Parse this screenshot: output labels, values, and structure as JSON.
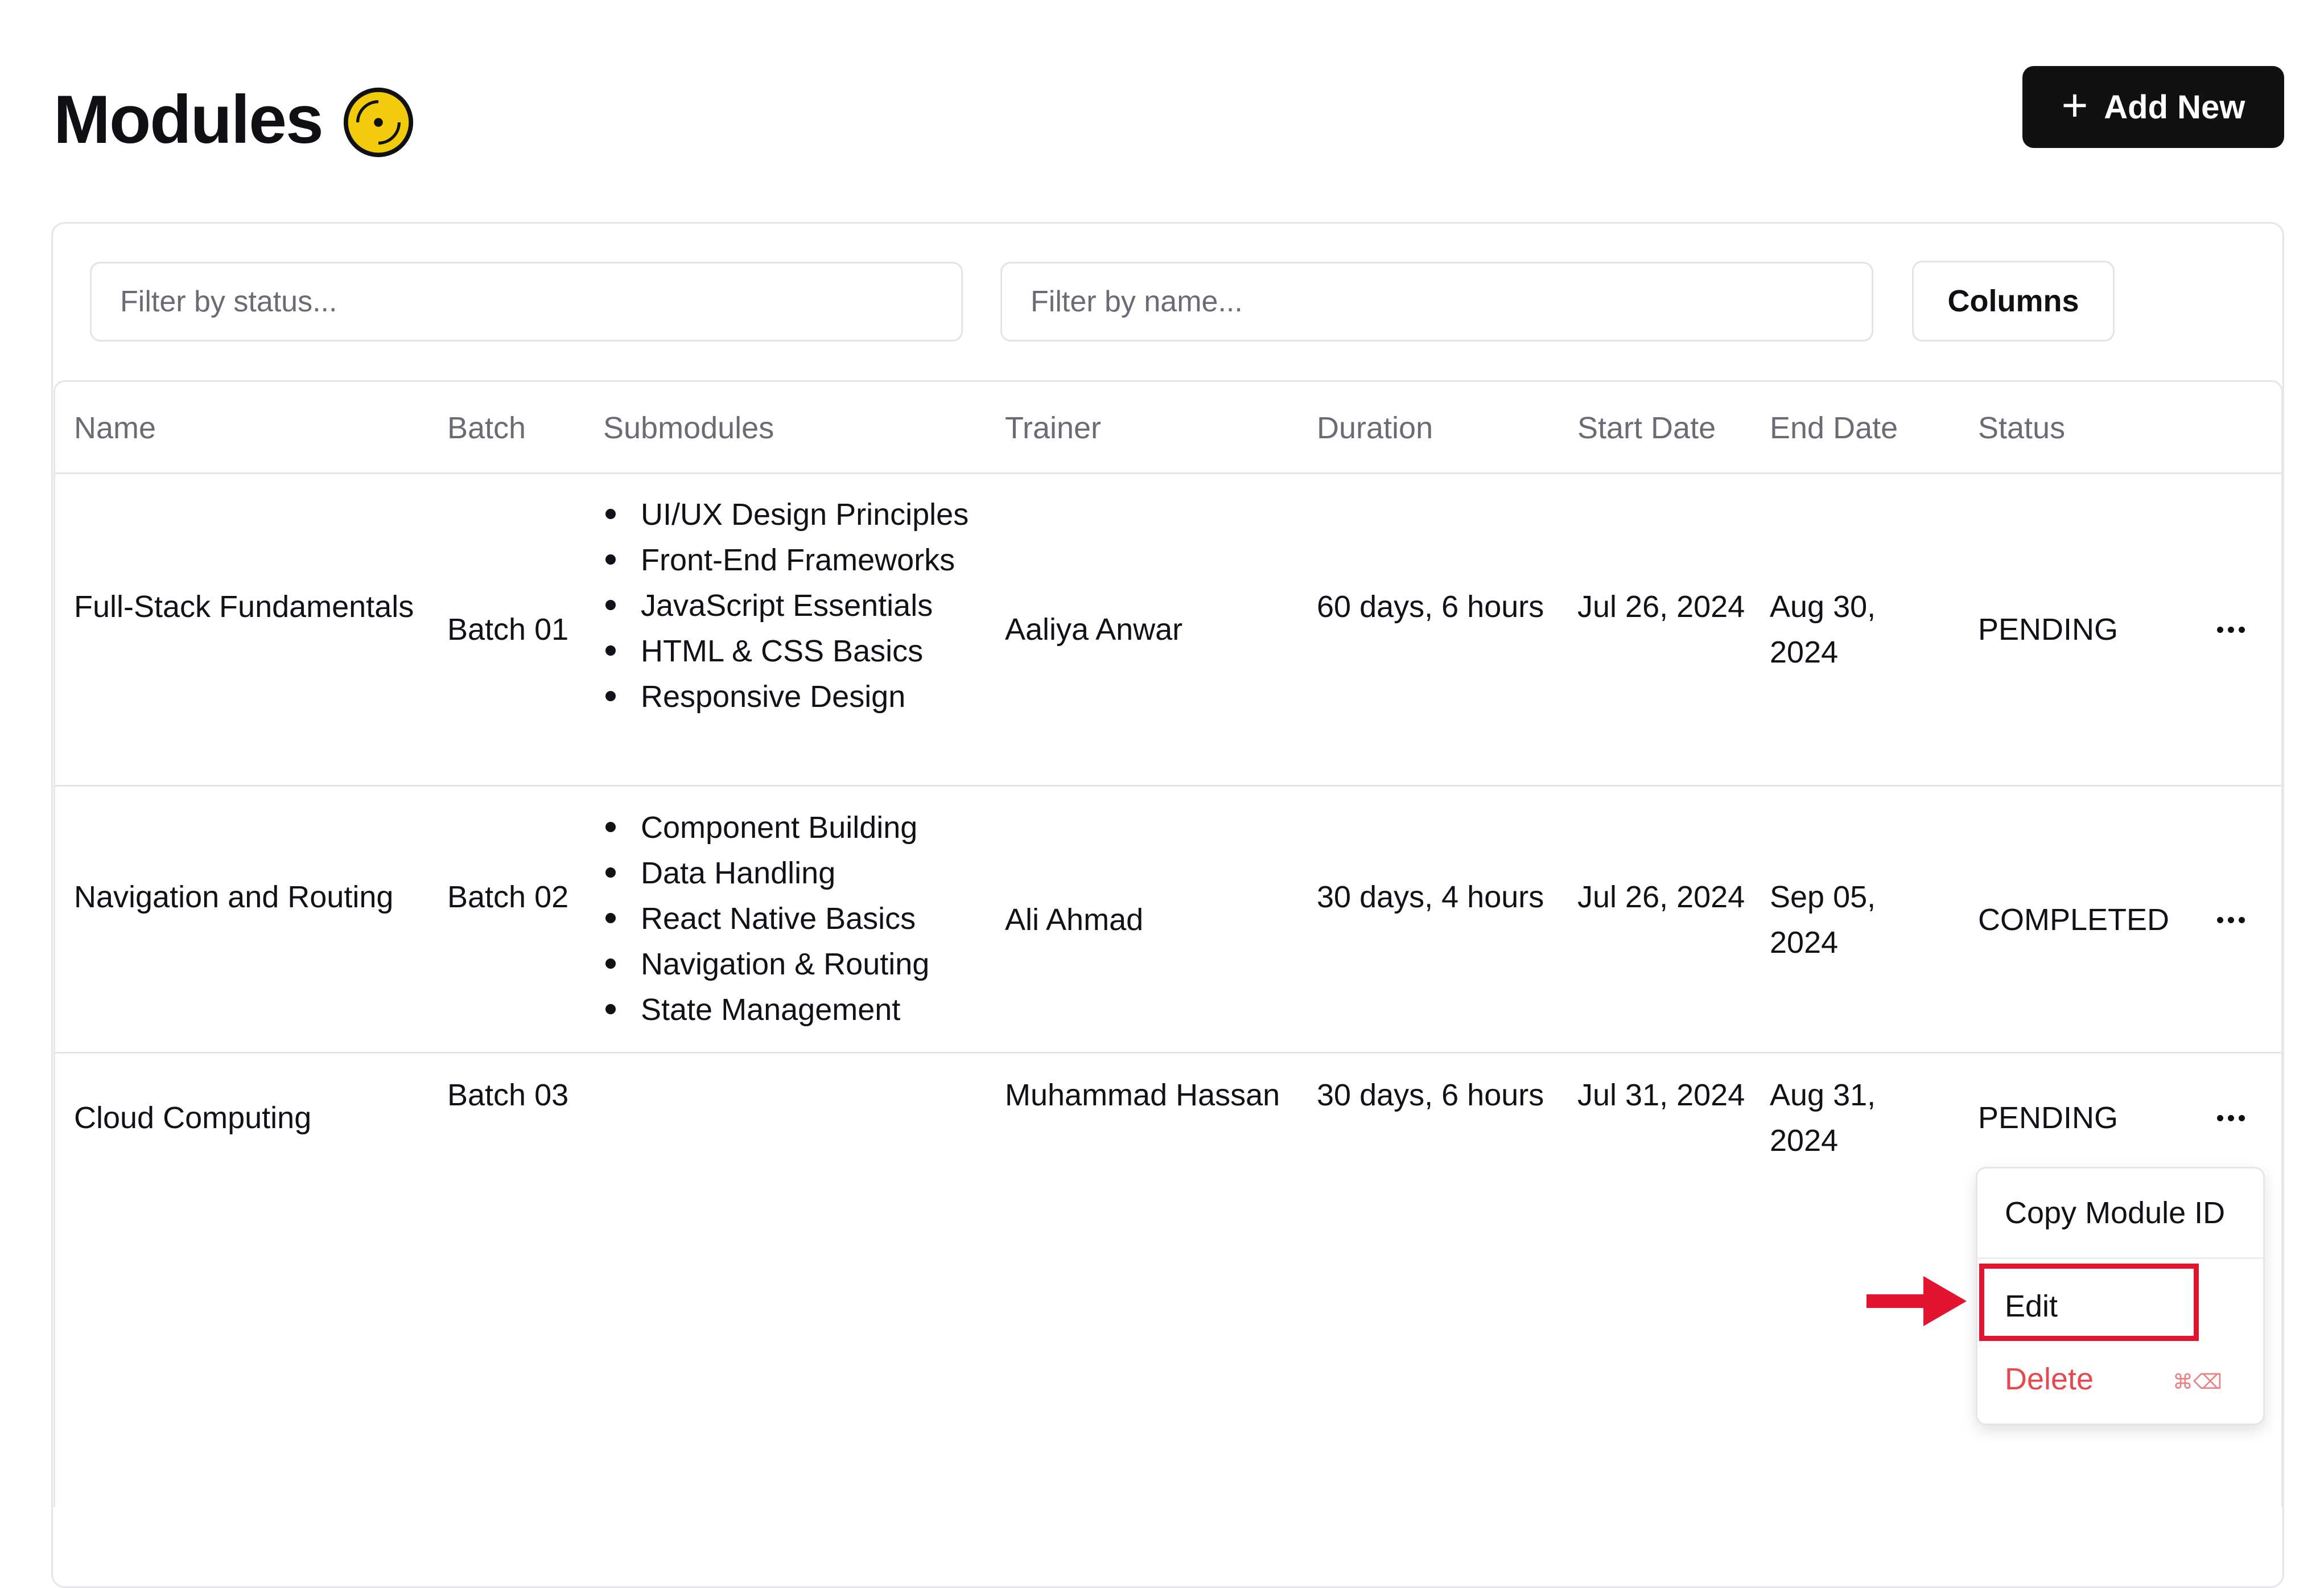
{
  "header": {
    "title": "Modules",
    "title_icon": "disc-icon",
    "add_new_label": "Add New"
  },
  "filters": {
    "status_placeholder": "Filter by status...",
    "name_placeholder": "Filter by name...",
    "columns_label": "Columns"
  },
  "table": {
    "headers": {
      "name": "Name",
      "batch": "Batch",
      "submodules": "Submodules",
      "trainer": "Trainer",
      "duration": "Duration",
      "start_date": "Start Date",
      "end_date": "End Date",
      "status": "Status"
    },
    "rows": [
      {
        "name": "Full-Stack Fundamentals",
        "batch": "Batch 01",
        "submodules": [
          "UI/UX Design Principles",
          "Front-End Frameworks",
          "JavaScript Essentials",
          "HTML & CSS Basics",
          "Responsive Design"
        ],
        "trainer": "Aaliya Anwar",
        "duration": "60 days, 6 hours",
        "start_date": "Jul 26, 2024",
        "end_date": "Aug 30, 2024",
        "status": "PENDING"
      },
      {
        "name": "Navigation and Routing",
        "batch": "Batch 02",
        "submodules": [
          "Component Building",
          "Data Handling",
          "React Native Basics",
          "Navigation & Routing",
          "State Management"
        ],
        "trainer": "Ali Ahmad",
        "duration": "30 days, 4 hours",
        "start_date": "Jul 26, 2024",
        "end_date": "Sep 05, 2024",
        "status": "COMPLETED"
      },
      {
        "name": "Cloud Computing",
        "batch": "Batch 03",
        "submodules": [],
        "trainer": "Muhammad Hassan",
        "duration": "30 days, 6 hours",
        "start_date": "Jul 31, 2024",
        "end_date": "Aug 31, 2024",
        "status": "PENDING"
      }
    ]
  },
  "row_menu": {
    "copy_id_label": "Copy Module ID",
    "edit_label": "Edit",
    "delete_label": "Delete",
    "delete_shortcut": "⌘⌫"
  },
  "colors": {
    "primary_button": "#111111",
    "danger": "#e5484d",
    "highlight": "#e3142f",
    "icon_yellow": "#f2cc0c"
  }
}
